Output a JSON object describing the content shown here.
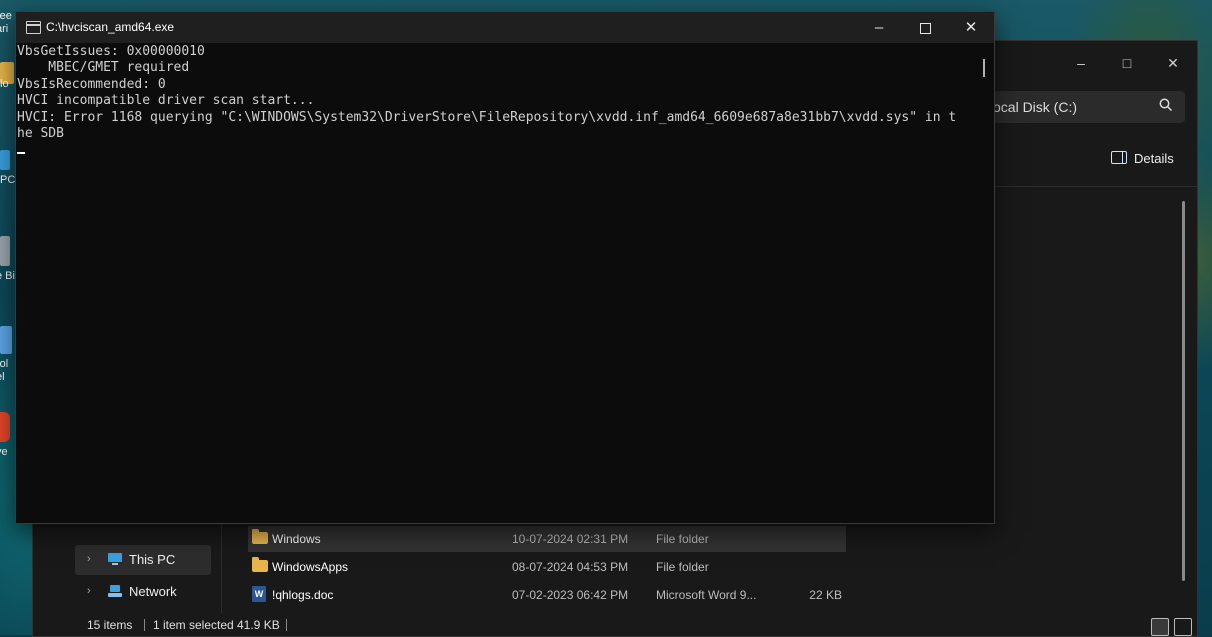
{
  "desktop": {
    "icons": [
      {
        "label": "ree\nari",
        "icon": "app-icon"
      },
      {
        "label": "lo",
        "icon": "folder-icon"
      },
      {
        "label": "PC",
        "icon": "this-pc-icon"
      },
      {
        "label": "e Bi",
        "icon": "recycle-bin-icon"
      },
      {
        "label": "rol\nel",
        "icon": "control-panel-icon"
      },
      {
        "label": "ve",
        "icon": "brave-icon"
      }
    ]
  },
  "explorer": {
    "address": "ocal Disk (C:)",
    "details_label": "Details",
    "nav": [
      {
        "label": "This PC",
        "icon": "this-pc-icon"
      },
      {
        "label": "Network",
        "icon": "network-icon"
      }
    ],
    "files": [
      {
        "name": "Windows",
        "date": "10-07-2024 02:31 PM",
        "type": "File folder",
        "size": "",
        "icon": "folder-icon"
      },
      {
        "name": "WindowsApps",
        "date": "08-07-2024 04:53 PM",
        "type": "File folder",
        "size": "",
        "icon": "folder-icon"
      },
      {
        "name": "!qhlogs.doc",
        "date": "07-02-2023 06:42 PM",
        "type": "Microsoft Word 9...",
        "size": "22 KB",
        "icon": "word-doc-icon"
      }
    ],
    "status": {
      "items_count": "15 items",
      "selected": "1 item selected",
      "selected_size": "41.9 KB"
    }
  },
  "console": {
    "title": "C:\\hvciscan_amd64.exe",
    "lines": [
      "VbsGetIssues: 0x00000010",
      "    MBEC/GMET required",
      "VbsIsRecommended: 0",
      "HVCI incompatible driver scan start...",
      "HVCI: Error 1168 querying \"C:\\WINDOWS\\System32\\DriverStore\\FileRepository\\xvdd.inf_amd64_6609e687a8e31bb7\\xvdd.sys\" in t",
      "he SDB"
    ]
  },
  "colors": {
    "console_bg": "#0c0c0c",
    "console_text": "#d0d0d0",
    "folder": "#e8b54a",
    "word": "#2b5797"
  }
}
